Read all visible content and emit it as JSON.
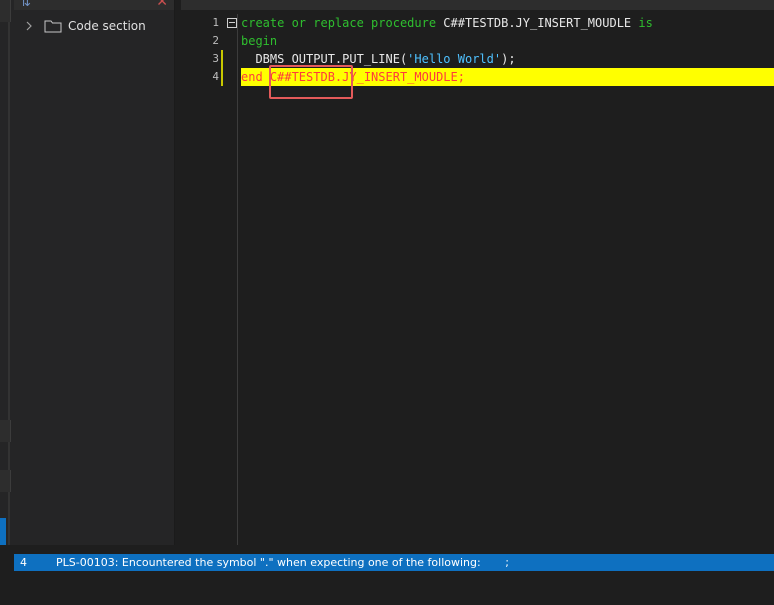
{
  "tree": {
    "items": [
      {
        "label": "Code section"
      }
    ]
  },
  "editor": {
    "line_numbers": [
      "1",
      "2",
      "3",
      "4"
    ],
    "lines": [
      {
        "tokens": [
          {
            "text": "create or replace procedure ",
            "kind": "keyword"
          },
          {
            "text": "C##TESTDB.JY_INSERT_MOUDLE ",
            "kind": "identifier"
          },
          {
            "text": "is",
            "kind": "keyword"
          }
        ]
      },
      {
        "tokens": [
          {
            "text": "begin",
            "kind": "keyword"
          }
        ]
      },
      {
        "tokens": [
          {
            "text": "  DBMS_OUTPUT.PUT_LINE(",
            "kind": "identifier"
          },
          {
            "text": "'Hello World'",
            "kind": "string"
          },
          {
            "text": ");",
            "kind": "identifier"
          }
        ]
      },
      {
        "highlighted": true,
        "tokens": [
          {
            "text": "end C##TESTDB.JY_INSERT_MOUDLE;",
            "kind": "error"
          }
        ]
      }
    ]
  },
  "error_panel": {
    "rows": [
      {
        "line": "4",
        "message": "PLS-00103: Encountered the symbol \".\" when expecting one of the following:       ;"
      }
    ]
  },
  "colors": {
    "keyword": "#2fbf2f",
    "identifier": "#e8e8e8",
    "string": "#4fc1ff",
    "error_text": "#ff3b3b",
    "line_highlight": "#ffff00",
    "error_row": "#0e70c0",
    "annotation_box": "#e45a5a"
  },
  "icons": [
    "sort-icon",
    "close-icon",
    "chevron-right-icon",
    "folder-icon",
    "fold-minus-icon"
  ]
}
